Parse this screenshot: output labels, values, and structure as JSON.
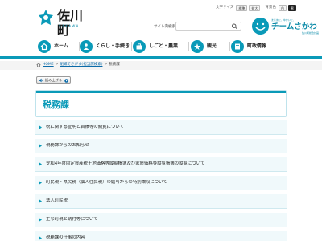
{
  "header": {
    "logo_text": "佐川町",
    "logo_sub": "SAKAWA",
    "util": {
      "font_size_label": "文字サイズ",
      "standard": "標準",
      "enlarge": "拡大",
      "bg_color_label": "背景色",
      "white": "白",
      "black": "黒"
    },
    "site_search_label": "サイト内検索",
    "search_placeholder": "",
    "team": {
      "tagline": "まじめに、ゆかいに、",
      "name": "チームさかわ",
      "footer": "佐川町総合計画"
    }
  },
  "nav": {
    "items": [
      {
        "label": "ホーム",
        "icon": "home-icon"
      },
      {
        "label": "くらし・手続き",
        "icon": "people-icon"
      },
      {
        "label": "しごと・農業",
        "icon": "work-icon"
      },
      {
        "label": "観光",
        "icon": "tourism-icon"
      },
      {
        "label": "町政情報",
        "icon": "town-info-icon"
      }
    ]
  },
  "breadcrumb": {
    "items": [
      "HOME",
      "組織でさがす(担当課検索)"
    ],
    "current": "税務課"
  },
  "read_aloud": {
    "label": "読み上げる"
  },
  "main": {
    "title": "税務課",
    "items": [
      "税に関する証明と台帳等の閲覧について",
      "税務課からのお知らせ",
      "令和4年度固定資産税土地価格等縦覧帳簿及び家屋価格等縦覧帳簿の縦覧について",
      "町民税・県民税（個人住民税）の給与からの特別徴収について",
      "法人町民税",
      "主な町税と納付等について",
      "税務課の仕事の内容"
    ]
  },
  "colors": {
    "accent": "#0a9ab8",
    "row_bg": "#f0f9fb",
    "link": "#0a6aa8"
  }
}
